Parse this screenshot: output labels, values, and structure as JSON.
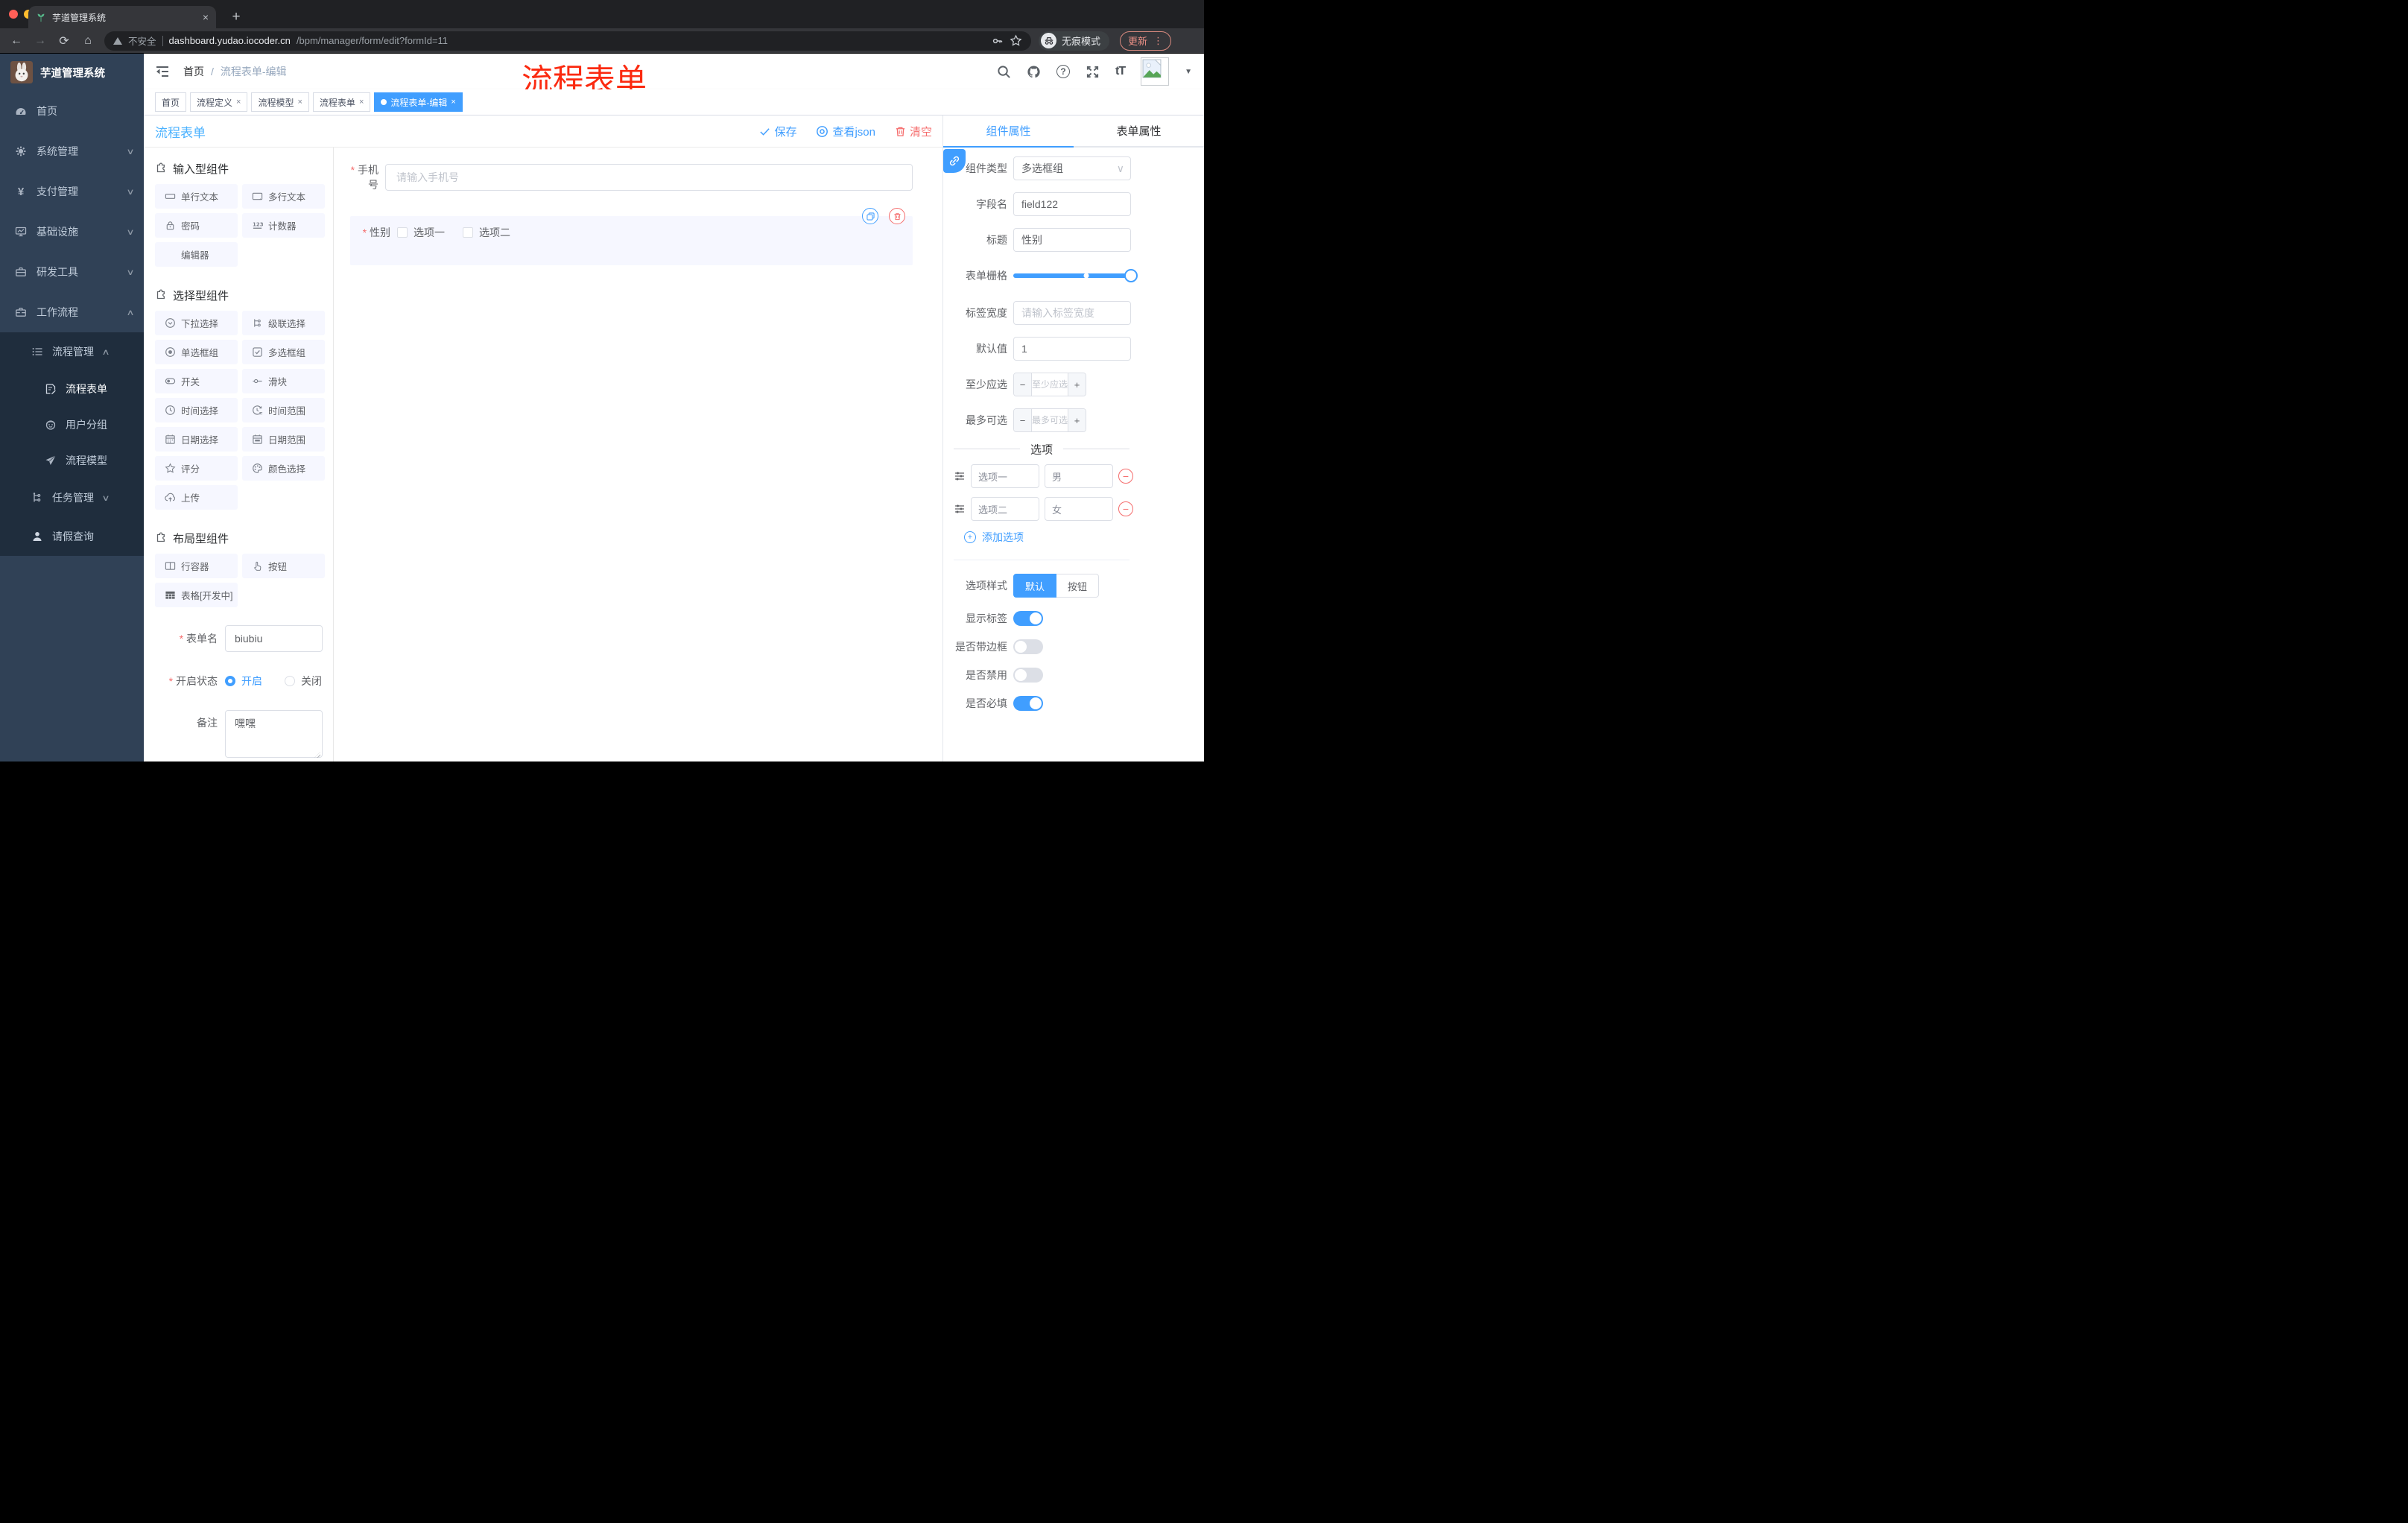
{
  "browser": {
    "tab_title": "芋道管理系统",
    "security_label": "不安全",
    "url_domain": "dashboard.yudao.iocoder.cn",
    "url_path": "/bpm/manager/form/edit?formId=11",
    "incognito_label": "无痕模式",
    "update_label": "更新"
  },
  "glyphs": {
    "close": "×",
    "more": "⋮",
    "caret": "▼",
    "back": "←",
    "forward": "→",
    "reload": "⟳",
    "home": "⌂",
    "plus": "+",
    "minus": "−",
    "newtab": "+",
    "tT": "tT",
    "question": "?",
    "yen": "¥",
    "slash": "/",
    "dropdown_arrow": "∨",
    "chevron_down": "∨",
    "chevron_up": "∧"
  },
  "sidebar": {
    "app_title": "芋道管理系统",
    "items": [
      "首页",
      "系统管理",
      "支付管理",
      "基础设施",
      "研发工具",
      "工作流程"
    ],
    "subitems": [
      "流程管理",
      "流程表单",
      "用户分组",
      "流程模型",
      "任务管理",
      "请假查询"
    ]
  },
  "header": {
    "breadcrumb_home": "首页",
    "breadcrumb_current": "流程表单-编辑",
    "annotation": "流程表单"
  },
  "tags": [
    "首页",
    "流程定义",
    "流程模型",
    "流程表单",
    "流程表单-编辑"
  ],
  "toolbar": {
    "title": "流程表单",
    "save": "保存",
    "view_json": "查看json",
    "clear": "清空"
  },
  "palette": {
    "sections": [
      {
        "title": "输入型组件",
        "items": [
          "单行文本",
          "多行文本",
          "密码",
          "计数器",
          "编辑器"
        ]
      },
      {
        "title": "选择型组件",
        "items": [
          "下拉选择",
          "级联选择",
          "单选框组",
          "多选框组",
          "开关",
          "滑块",
          "时间选择",
          "时间范围",
          "日期选择",
          "日期范围",
          "评分",
          "颜色选择",
          "上传"
        ]
      },
      {
        "title": "布局型组件",
        "items": [
          "行容器",
          "按钮",
          "表格[开发中]"
        ]
      }
    ],
    "form": {
      "name_label": "表单名",
      "name_value": "biubiu",
      "status_label": "开启状态",
      "status_on": "开启",
      "status_off": "关闭",
      "remark_label": "备注",
      "remark_value": "嘿嘿"
    }
  },
  "canvas": {
    "phone_label": "手机号",
    "phone_placeholder": "请输入手机号",
    "gender_label": "性别",
    "gender_options": [
      "选项一",
      "选项二"
    ]
  },
  "inspector": {
    "tab_component": "组件属性",
    "tab_form": "表单属性",
    "type_label": "组件类型",
    "type_value": "多选框组",
    "field_label": "字段名",
    "field_value": "field122",
    "title_label": "标题",
    "title_value": "性别",
    "grid_label": "表单栅格",
    "label_width_label": "标签宽度",
    "label_width_placeholder": "请输入标签宽度",
    "default_label": "默认值",
    "default_value": "1",
    "min_label": "至少应选",
    "min_placeholder": "至少应选",
    "max_label": "最多可选",
    "max_placeholder": "最多可选",
    "options_divider": "选项",
    "options": [
      {
        "label": "选项一",
        "value": "男"
      },
      {
        "label": "选项二",
        "value": "女"
      }
    ],
    "add_option": "添加选项",
    "style_label": "选项样式",
    "style_default": "默认",
    "style_button": "按钮",
    "show_label_label": "显示标签",
    "border_label": "是否带边框",
    "disabled_label": "是否禁用",
    "required_label": "是否必填"
  },
  "colors": {
    "primary": "#409eff",
    "danger": "#f56c6c",
    "annotation_red": "#fb2a10",
    "sidebar_bg": "#304156",
    "submenu_bg": "#1f2d3d",
    "active_tag": "#409eff"
  }
}
